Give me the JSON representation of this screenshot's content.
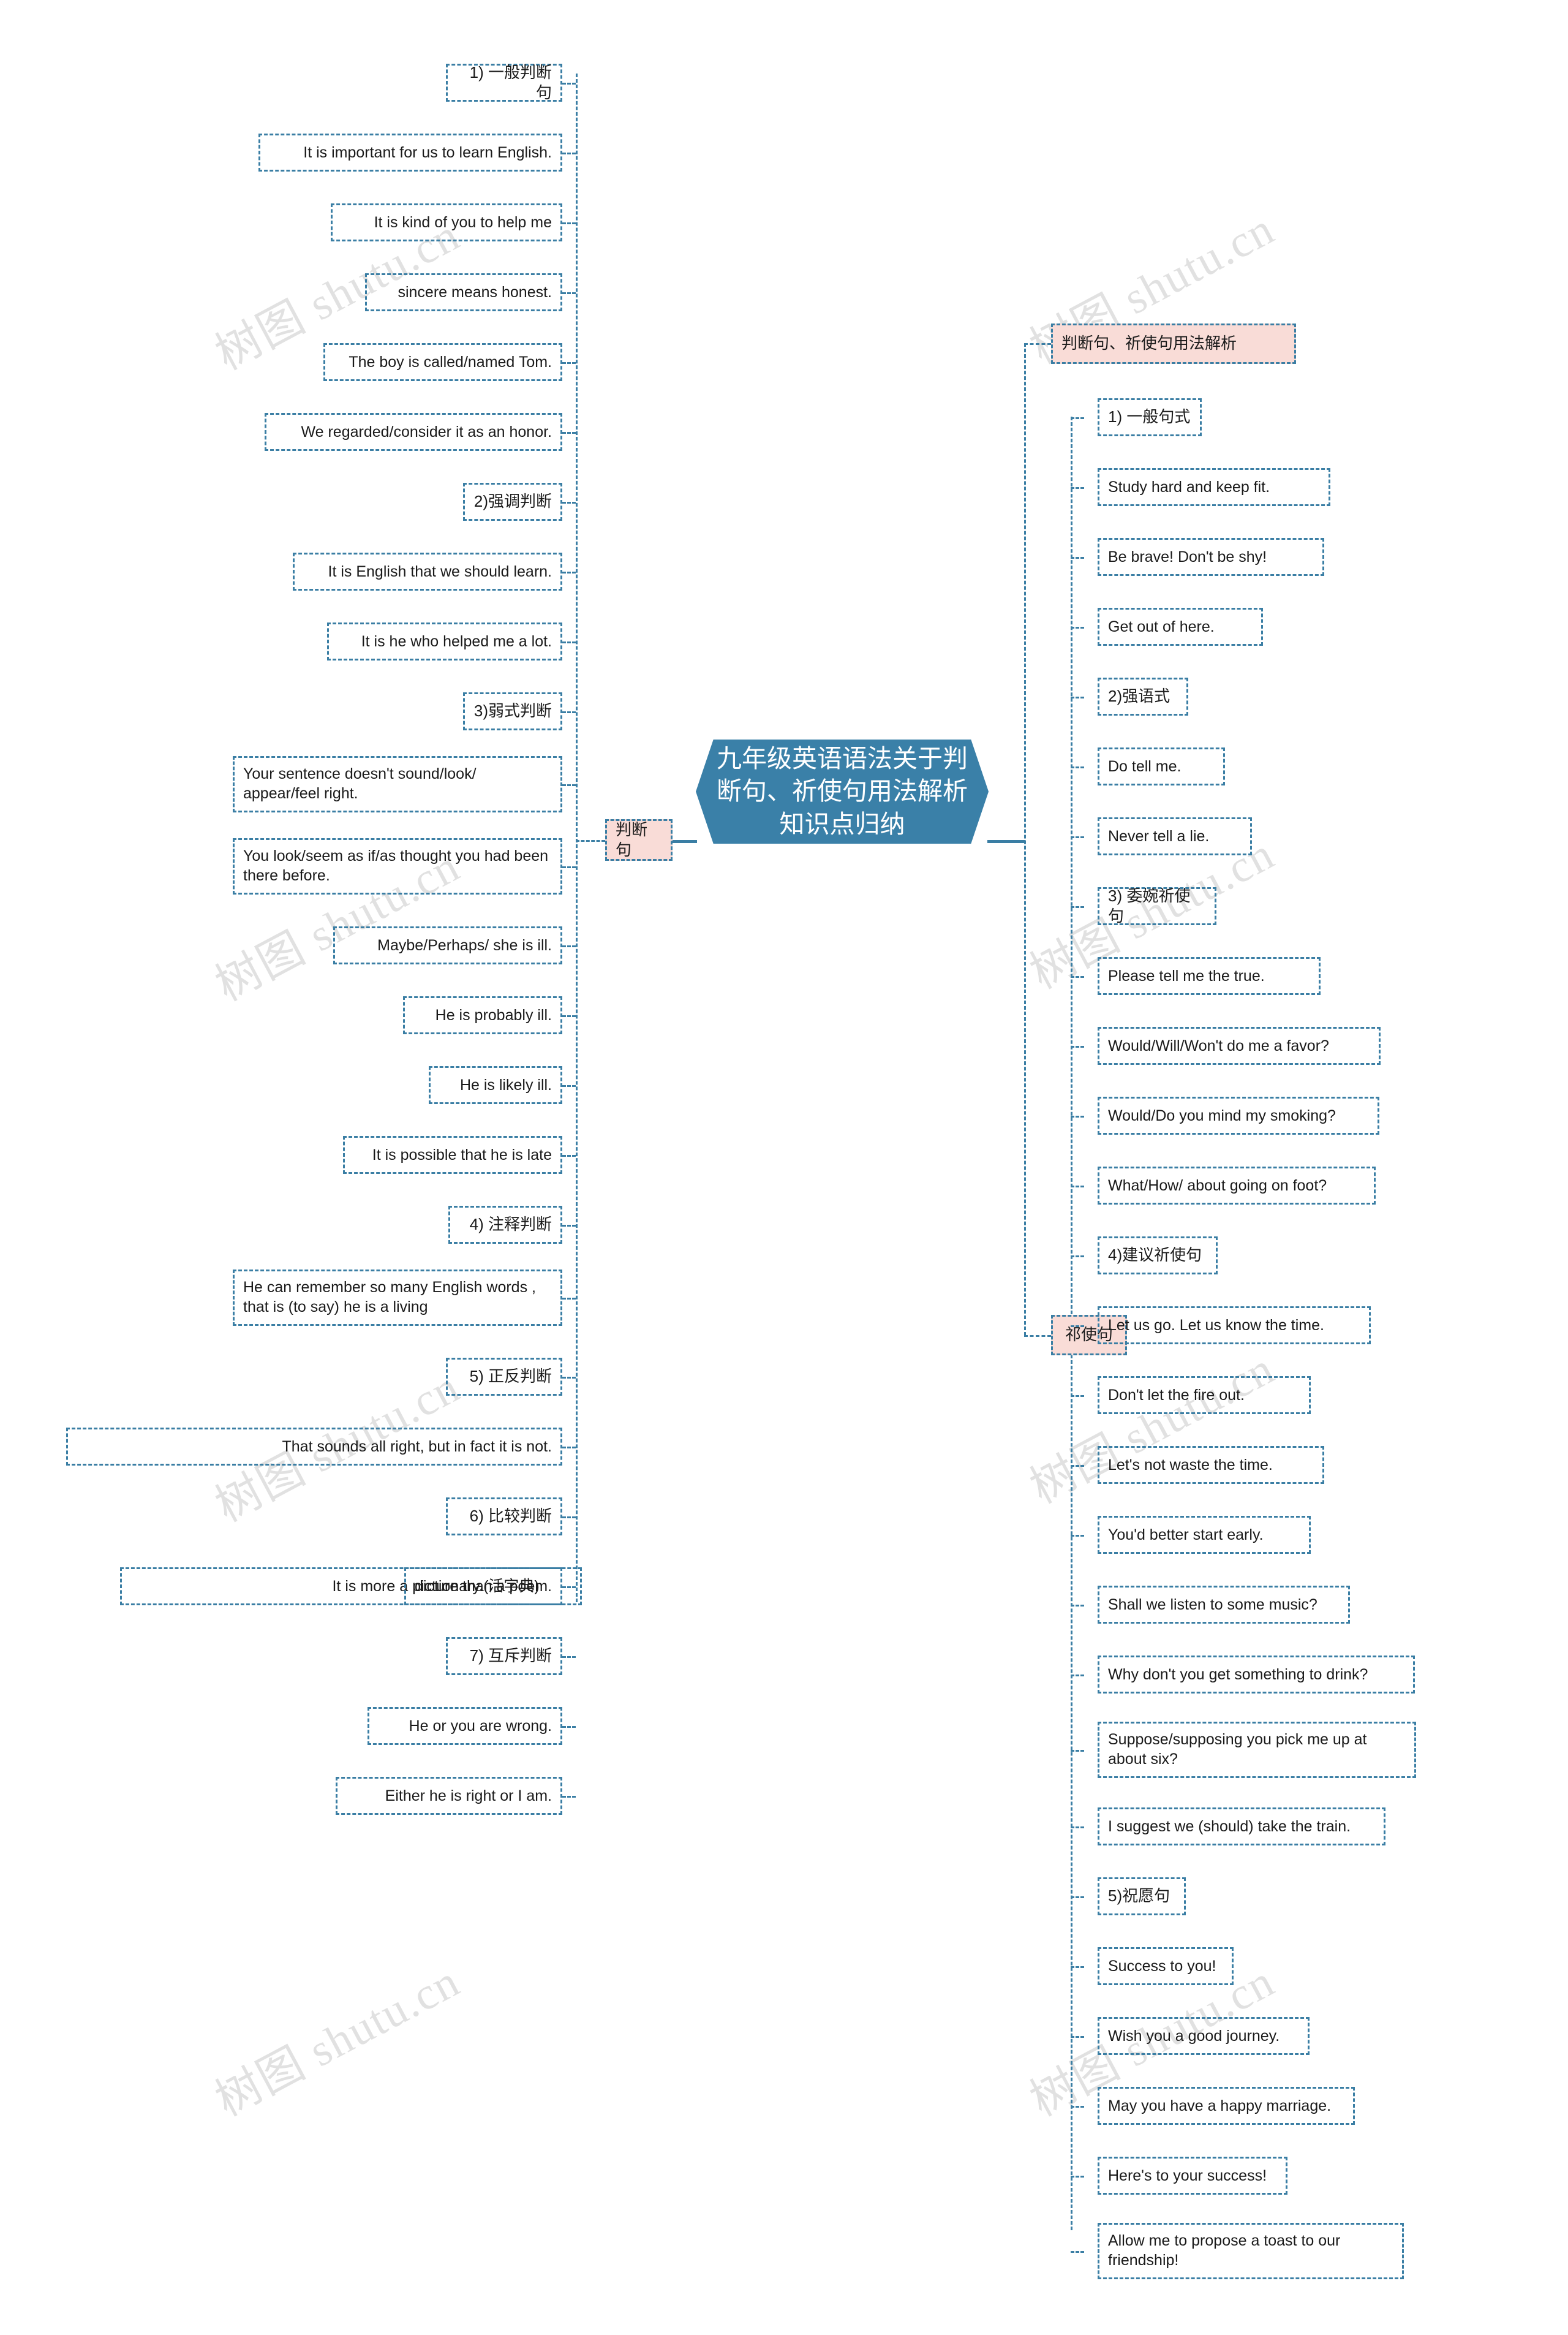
{
  "center": {
    "title": "九年级英语语法关于判断句、祈使句用法解析知识点归纳",
    "fill_color": "#3a80a8",
    "text_color": "#ffffff"
  },
  "theme": {
    "line_color": "#3a7ea4",
    "node_border": "#3a7ea4",
    "pink_fill": "#f9dcd7",
    "text_color": "#1a1a1a",
    "background": "#ffffff"
  },
  "watermark": {
    "text": "树图 shutu.cn"
  },
  "left_branch": {
    "label": "判断句",
    "nodes": [
      {
        "text": "1) 一般判断句",
        "kind": "cn"
      },
      {
        "text": "It is important for us to learn English.",
        "kind": "en"
      },
      {
        "text": "It is kind of you to help me",
        "kind": "en"
      },
      {
        "text": "sincere means honest.",
        "kind": "en"
      },
      {
        "text": "The boy is called/named Tom.",
        "kind": "en"
      },
      {
        "text": "We regarded/consider it as an honor.",
        "kind": "en"
      },
      {
        "text": "2)强调判断",
        "kind": "cn"
      },
      {
        "text": "It is English that we should learn.",
        "kind": "en"
      },
      {
        "text": "It is he who helped me a lot.",
        "kind": "en"
      },
      {
        "text": "3)弱式判断",
        "kind": "cn"
      },
      {
        "text": "Your sentence doesn't sound/look/ appear/feel right.",
        "kind": "en-multiline"
      },
      {
        "text": "You look/seem as if/as thought you had been there before.",
        "kind": "en-multiline"
      },
      {
        "text": "Maybe/Perhaps/ she is ill.",
        "kind": "en"
      },
      {
        "text": "He is probably ill.",
        "kind": "en"
      },
      {
        "text": "He is likely ill.",
        "kind": "en"
      },
      {
        "text": "It is possible that he is late",
        "kind": "en"
      },
      {
        "text": "4) 注释判断",
        "kind": "cn"
      },
      {
        "text": "He can remember so many English words , that is (to say) he is a living",
        "kind": "en-multiline"
      },
      {
        "text": "5) 正反判断",
        "kind": "cn"
      },
      {
        "text": "That sounds all right, but in fact it is not.",
        "kind": "en"
      },
      {
        "text": "6) 比较判断",
        "kind": "cn"
      },
      {
        "text": "It is more a picture than a poem.",
        "kind": "en"
      },
      {
        "text": "7) 互斥判断",
        "kind": "cn"
      },
      {
        "text": "He or you are wrong.",
        "kind": "en"
      },
      {
        "text": "Either he is right or I am.",
        "kind": "en"
      }
    ],
    "sub_node": {
      "text": "dictionary.(活字典)",
      "kind": "en"
    }
  },
  "right_branch": {
    "header": "判断句、祈使句用法解析",
    "label": "祁使句",
    "nodes": [
      {
        "text": "1) 一般句式",
        "kind": "cn"
      },
      {
        "text": "Study hard and keep fit.",
        "kind": "en"
      },
      {
        "text": "Be brave! Don't be shy!",
        "kind": "en"
      },
      {
        "text": "Get out of here.",
        "kind": "en"
      },
      {
        "text": "2)强语式",
        "kind": "cn"
      },
      {
        "text": "Do tell me.",
        "kind": "en"
      },
      {
        "text": "Never tell a lie.",
        "kind": "en"
      },
      {
        "text": "3) 委婉祈使句",
        "kind": "cn"
      },
      {
        "text": "Please tell me the true.",
        "kind": "en"
      },
      {
        "text": "Would/Will/Won't do me a favor?",
        "kind": "en"
      },
      {
        "text": "Would/Do you mind my smoking?",
        "kind": "en"
      },
      {
        "text": "What/How/ about going on foot?",
        "kind": "en"
      },
      {
        "text": "4)建议祈使句",
        "kind": "cn"
      },
      {
        "text": "Let us go. Let us know the time.",
        "kind": "en"
      },
      {
        "text": "Don't let the fire out.",
        "kind": "en"
      },
      {
        "text": "Let's not waste the time.",
        "kind": "en"
      },
      {
        "text": "You'd better start early.",
        "kind": "en"
      },
      {
        "text": "Shall we listen to some music?",
        "kind": "en"
      },
      {
        "text": "Why don't you get something to drink?",
        "kind": "en"
      },
      {
        "text": "Suppose/supposing you pick me up at about six?",
        "kind": "en-multiline"
      },
      {
        "text": "I suggest we (should) take the train.",
        "kind": "en"
      },
      {
        "text": "5)祝愿句",
        "kind": "cn"
      },
      {
        "text": "Success to you!",
        "kind": "en"
      },
      {
        "text": "Wish you a good journey.",
        "kind": "en"
      },
      {
        "text": "May you have a happy marriage.",
        "kind": "en"
      },
      {
        "text": "Here's to your success!",
        "kind": "en"
      },
      {
        "text": "Allow me to propose a toast to our friendship!",
        "kind": "en-multiline"
      }
    ]
  }
}
